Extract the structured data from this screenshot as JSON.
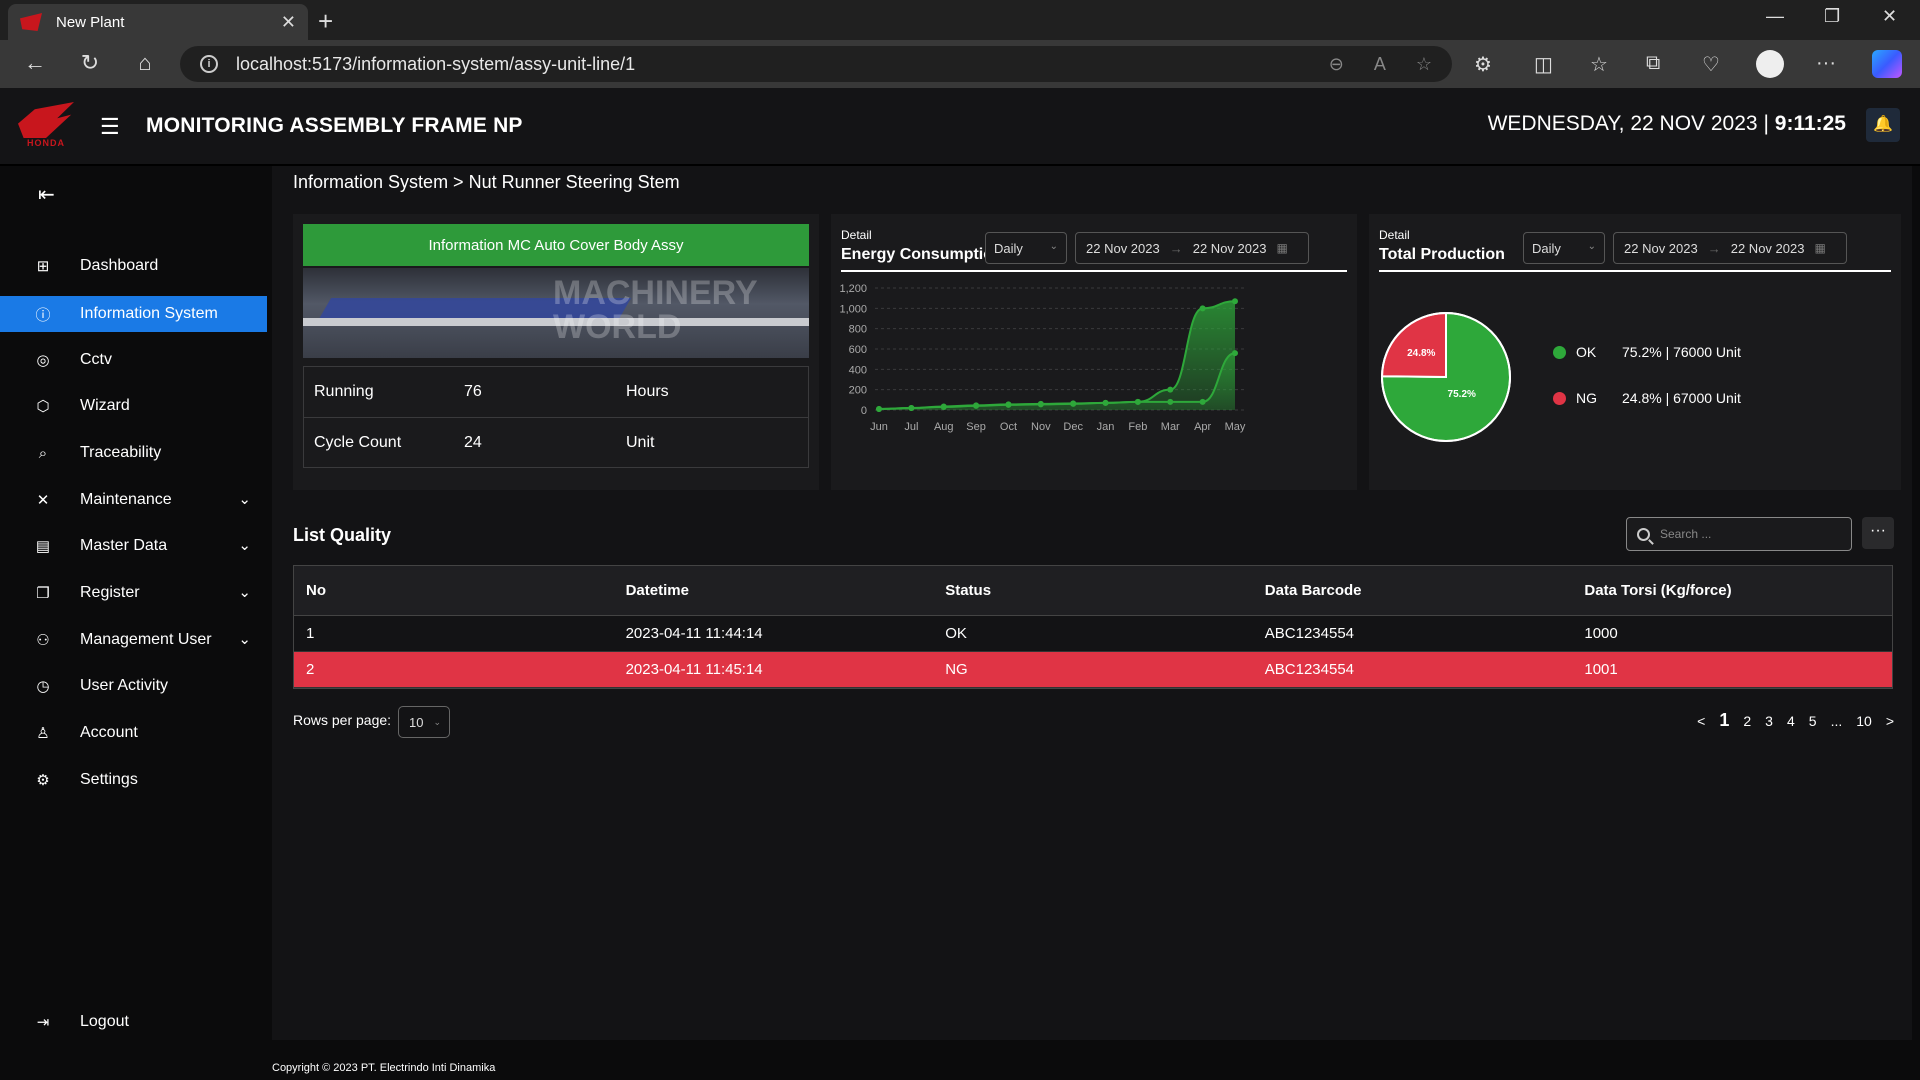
{
  "browser": {
    "tab_title": "New Plant",
    "url": "localhost:5173/information-system/assy-unit-line/1"
  },
  "header": {
    "logo_text": "HONDA",
    "title": "MONITORING ASSEMBLY FRAME NP",
    "date": "WEDNESDAY, 22 NOV 2023",
    "separator": "|",
    "time": "9:11:25"
  },
  "sidebar": {
    "items": [
      {
        "label": "Dashboard",
        "icon": "grid-icon"
      },
      {
        "label": "Information System",
        "icon": "info-icon"
      },
      {
        "label": "Cctv",
        "icon": "camera-icon"
      },
      {
        "label": "Wizard",
        "icon": "cube-icon"
      },
      {
        "label": "Traceability",
        "icon": "trace-icon"
      },
      {
        "label": "Maintenance",
        "icon": "tools-icon"
      },
      {
        "label": "Master Data",
        "icon": "document-icon"
      },
      {
        "label": "Register",
        "icon": "register-icon"
      },
      {
        "label": "Management User",
        "icon": "users-icon"
      },
      {
        "label": "User Activity",
        "icon": "history-icon"
      },
      {
        "label": "Account",
        "icon": "person-icon"
      },
      {
        "label": "Settings",
        "icon": "gear-icon"
      }
    ],
    "logout": "Logout"
  },
  "breadcrumb": "Information System > Nut Runner Steering Stem",
  "info": {
    "banner": "Information MC Auto Cover Body Assy",
    "watermark": "MACHINERY WORLD",
    "rows": [
      {
        "label": "Running",
        "value": "76",
        "unit": "Hours"
      },
      {
        "label": "Cycle Count",
        "value": "24",
        "unit": "Unit"
      }
    ]
  },
  "energy": {
    "subtitle": "Detail",
    "title": "Energy Consumption",
    "period": "Daily",
    "date_from": "22 Nov 2023",
    "date_to": "22 Nov 2023"
  },
  "production": {
    "subtitle": "Detail",
    "title": "Total Production",
    "period": "Daily",
    "date_from": "22 Nov 2023",
    "date_to": "22 Nov 2023",
    "legend": [
      {
        "name": "OK",
        "text": "75.2% | 76000 Unit",
        "color": "#2ea83a"
      },
      {
        "name": "NG",
        "text": "24.8% | 67000 Unit",
        "color": "#e03445"
      }
    ]
  },
  "chart_data": [
    {
      "type": "area",
      "title": "Energy Consumption",
      "categories": [
        "Jun",
        "Jul",
        "Aug",
        "Sep",
        "Oct",
        "Nov",
        "Dec",
        "Jan",
        "Feb",
        "Mar",
        "Apr",
        "May"
      ],
      "series": [
        {
          "values": [
            10,
            20,
            35,
            45,
            55,
            60,
            65,
            70,
            80,
            200,
            1000,
            1070
          ]
        },
        {
          "values": [
            10,
            20,
            30,
            40,
            50,
            55,
            60,
            70,
            80,
            80,
            80,
            560
          ]
        }
      ],
      "ylim": [
        0,
        1200
      ],
      "yticks": [
        0,
        200,
        400,
        600,
        800,
        "1,000",
        "1,200"
      ],
      "color": "#2ea83a",
      "grid": true
    },
    {
      "type": "pie",
      "title": "Total Production",
      "labels": [
        "OK",
        "NG"
      ],
      "values": [
        75.2,
        24.8
      ],
      "slice_labels": [
        "75.2%",
        "24.8%"
      ],
      "colors": [
        "#2ea83a",
        "#e03445"
      ]
    }
  ],
  "list": {
    "title": "List Quality",
    "search_placeholder": "Search ...",
    "more": "···",
    "columns": [
      "No",
      "Datetime",
      "Status",
      "Data Barcode",
      "Data Torsi (Kg/force)"
    ],
    "rows": [
      [
        "1",
        "2023-04-11 11:44:14",
        "OK",
        "ABC1234554",
        "1000"
      ],
      [
        "2",
        "2023-04-11 11:45:14",
        "NG",
        "ABC1234554",
        "1001"
      ]
    ],
    "rows_per_page_label": "Rows per page:",
    "rows_per_page": "10",
    "pages": [
      "<",
      "1",
      "2",
      "3",
      "4",
      "5",
      "...",
      "10",
      ">"
    ]
  },
  "footer": "Copyright © 2023 PT. Electrindo Inti Dinamika"
}
